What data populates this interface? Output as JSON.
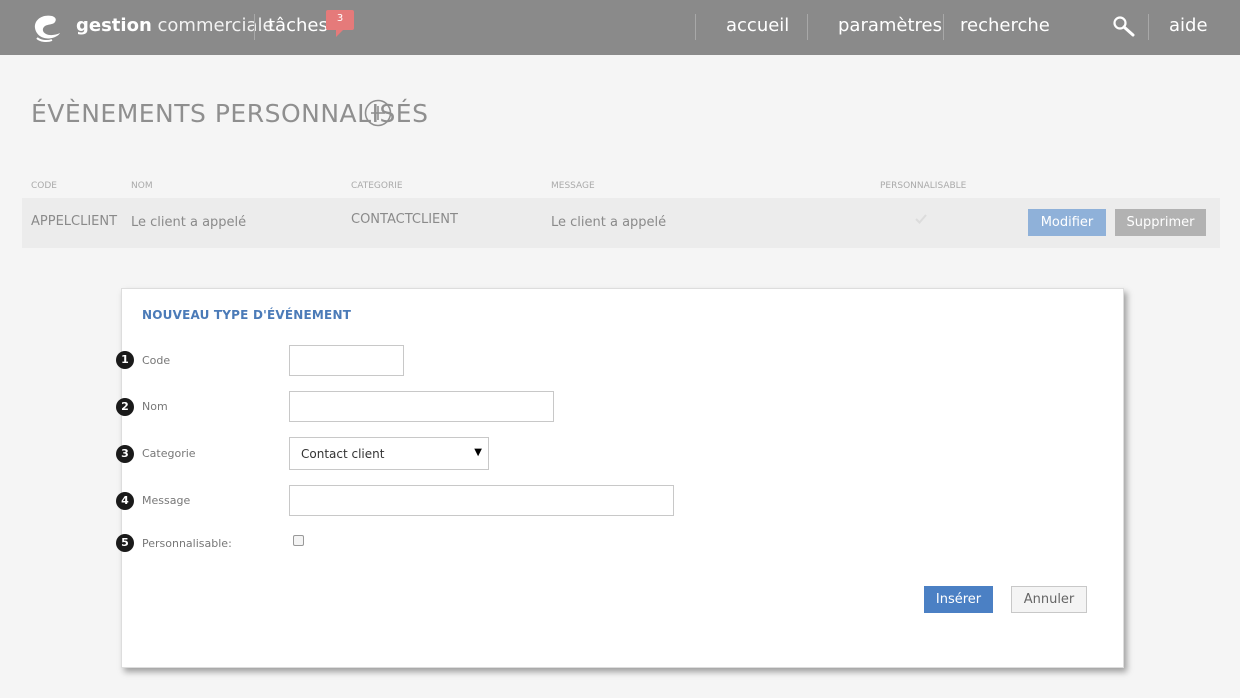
{
  "topbar": {
    "brand_bold": "gestion",
    "brand_light": "commerciale",
    "tasks_label": "tâches",
    "tasks_badge": "3",
    "nav_home": "accueil",
    "nav_settings": "paramètres",
    "nav_search": "recherche",
    "nav_help": "aide"
  },
  "page": {
    "title": "ÉVÈNEMENTS PERSONNALISÉS"
  },
  "table": {
    "headers": [
      "CODE",
      "NOM",
      "CATEGORIE",
      "MESSAGE",
      "PERSONNALISABLE"
    ],
    "rows": [
      {
        "code": "APPELCLIENT",
        "nom": "Le client a appelé",
        "categorie": "CONTACTCLIENT",
        "message": "Le client a appelé",
        "personnalisable": true
      }
    ],
    "edit_label": "Modifier",
    "delete_label": "Supprimer"
  },
  "modal": {
    "title": "NOUVEAU TYPE D'ÉVÉNEMENT",
    "fields": [
      {
        "num": "1",
        "label": "Code",
        "value": ""
      },
      {
        "num": "2",
        "label": "Nom",
        "value": ""
      },
      {
        "num": "3",
        "label": "Categorie",
        "value": "Contact client"
      },
      {
        "num": "4",
        "label": "Message",
        "value": ""
      },
      {
        "num": "5",
        "label": "Personnalisable:",
        "value": false
      }
    ],
    "insert_label": "Insérer",
    "cancel_label": "Annuler"
  },
  "colors": {
    "topbar": "#8a8a8a",
    "badge": "#e57a7a",
    "primary": "#4b80c4",
    "edit_button": "#8fb1d9",
    "delete_button": "#b2b2b2"
  },
  "icons": [
    "app-logo-icon",
    "search-icon",
    "add-circle-icon",
    "check-icon",
    "chevron-down-icon"
  ]
}
